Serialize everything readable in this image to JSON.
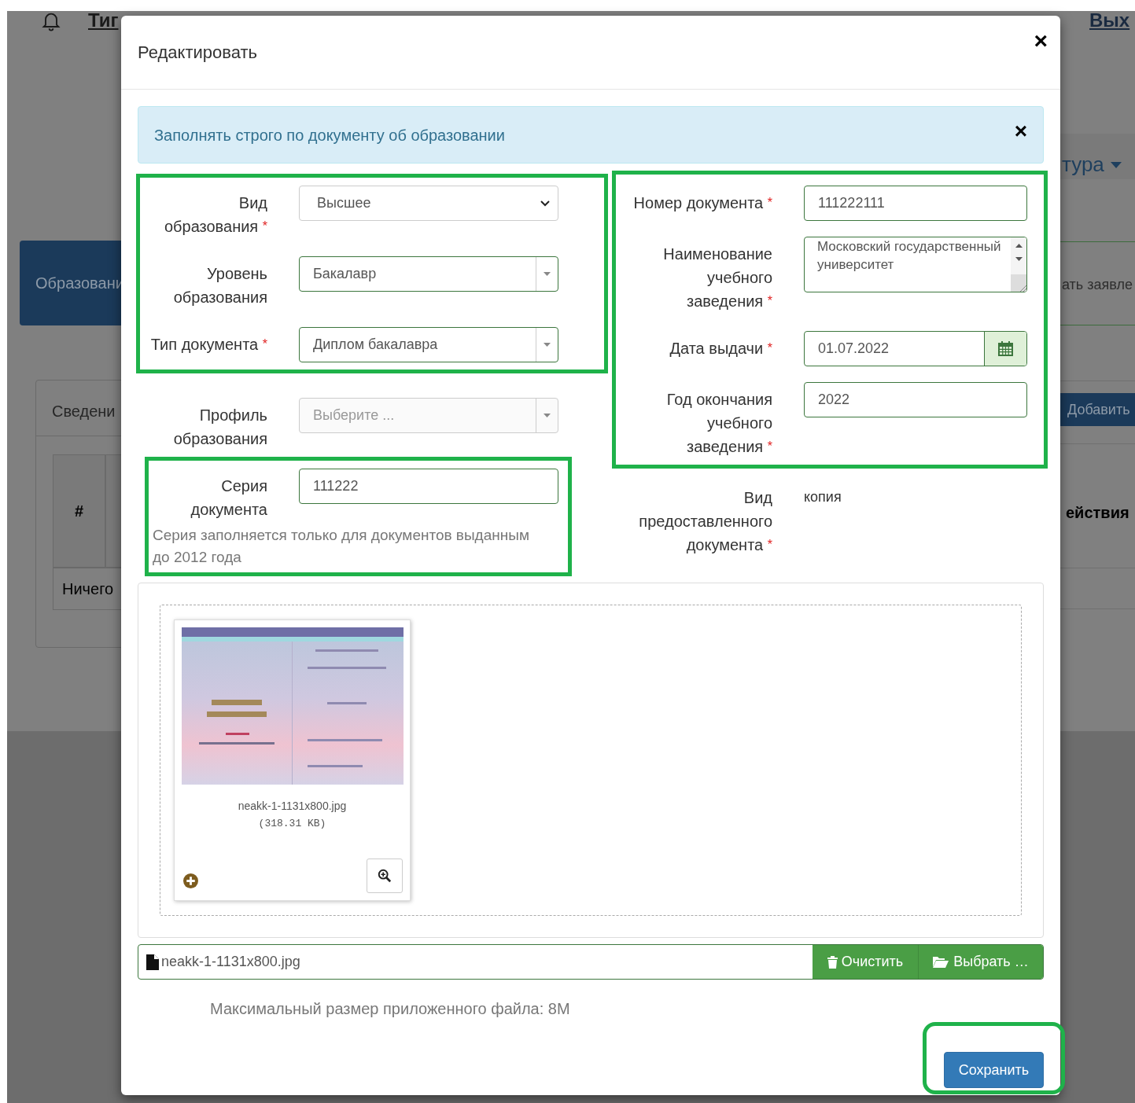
{
  "background": {
    "header": {
      "user_link": "Тиг",
      "exit_link": "Вых"
    },
    "tab": "Образовани",
    "menu_link": "тура",
    "side_link": "ать заявле",
    "panel": {
      "title": "Сведени",
      "add_button": "Добавить",
      "columns": [
        "#",
        "ействия"
      ],
      "empty_row": "Ничего"
    }
  },
  "modal": {
    "title": "Редактировать",
    "close": "×",
    "alert": {
      "text": "Заполнять строго по документу об образовании",
      "close": "×"
    },
    "required_mark": "*",
    "left_fields": [
      {
        "kind": "select",
        "label": "Вид образования",
        "required": true,
        "value": "Высшее"
      },
      {
        "kind": "combobox",
        "label": "Уровень образования",
        "required": false,
        "value": "Бакалавр"
      },
      {
        "kind": "combobox",
        "label": "Тип документа",
        "required": true,
        "value": "Диплом бакалавра"
      },
      {
        "kind": "combobox",
        "label": "Профиль образования",
        "required": false,
        "placeholder": "Выберите ...",
        "disabled": true
      },
      {
        "kind": "text",
        "label": "Серия документа",
        "required": false,
        "value": "111222",
        "hint": "Серия заполняется только для документов выданным до 2012 года"
      }
    ],
    "right_fields": [
      {
        "kind": "text",
        "label": "Номер документа",
        "required": true,
        "value": "111222111"
      },
      {
        "kind": "textarea",
        "label": "Наименование учебного заведения",
        "required": true,
        "value": "Московский государственный университет"
      },
      {
        "kind": "date",
        "label": "Дата выдачи",
        "required": true,
        "value": "01.07.2022"
      },
      {
        "kind": "text",
        "label": "Год окончания учебного заведения",
        "required": true,
        "value": "2022"
      },
      {
        "kind": "static",
        "label": "Вид предоставленного документа",
        "required": true,
        "value": "копия"
      }
    ],
    "upload": {
      "file_name": "neakk-1-1131x800.jpg",
      "file_size": "(318.31 KB)",
      "input_value": "neakk-1-1131x800.jpg",
      "clear_button": "Очистить",
      "browse_button": "Выбрать …",
      "note": "Максимальный размер приложенного файла: 8M"
    },
    "save_button": "Сохранить"
  }
}
